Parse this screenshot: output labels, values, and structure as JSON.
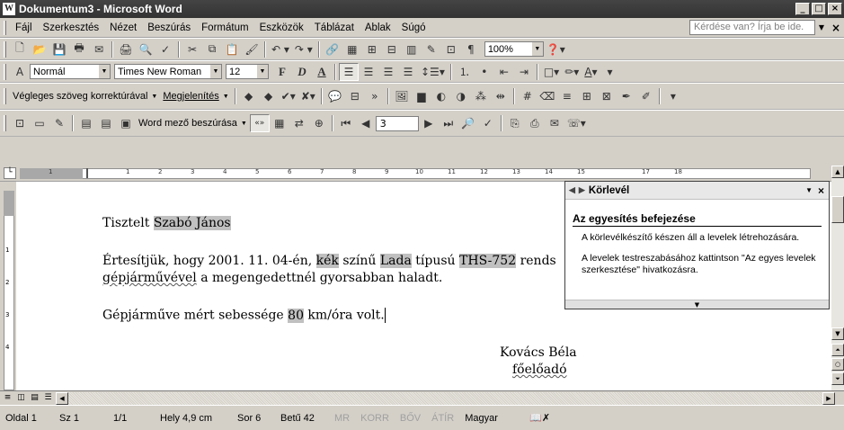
{
  "window": {
    "title": "Dokumentum3 - Microsoft Word",
    "minimize": "_",
    "maximize": "□",
    "close": "×"
  },
  "menu": {
    "items": [
      {
        "label": "Fájl"
      },
      {
        "label": "Szerkesztés"
      },
      {
        "label": "Nézet"
      },
      {
        "label": "Beszúrás"
      },
      {
        "label": "Formátum"
      },
      {
        "label": "Eszközök"
      },
      {
        "label": "Táblázat"
      },
      {
        "label": "Ablak"
      },
      {
        "label": "Súgó"
      }
    ],
    "help_placeholder": "Kérdése van? Írja be ide.",
    "close": "×"
  },
  "standard_toolbar": {
    "zoom": "100%"
  },
  "formatting_toolbar": {
    "style": "Normál",
    "font": "Times New Roman",
    "size": "12",
    "bold": "F",
    "italic": "D",
    "underline": "A"
  },
  "reviewing_toolbar": {
    "view": "Végleges szöveg korrektúrával",
    "show": "Megjelenítés"
  },
  "mailmerge_toolbar": {
    "insert_field": "Word mező beszúrása",
    "abc_label": "«»",
    "record": "3"
  },
  "document": {
    "line1_prefix": "Tisztelt ",
    "line1_field": "Szabó János",
    "line2_a": "Értesítjük, hogy 2001. 11. 04-én, ",
    "line2_color": "kék",
    "line2_b": " színű ",
    "line2_brand": "Lada",
    "line2_c": " típusú ",
    "line2_plate": "THS-752",
    "line2_d": " rends",
    "line3_word": "gépjárművével",
    "line3_rest": " a megengedettnél gyorsabban haladt.",
    "line4_a": "Gépjárműve mért sebessége ",
    "line4_speed": "80",
    "line4_b": " km/óra volt.",
    "sig_name": "Kovács Béla",
    "sig_title": "főelőadó"
  },
  "taskpane": {
    "title": "Körlevél",
    "section": "Az egyesítés befejezése",
    "p1": "A körlevélkészítő készen áll a levelek létrehozására.",
    "p2": "A levelek testreszabásához kattintson \"Az egyes levelek szerkesztése\" hivatkozásra."
  },
  "statusbar": {
    "page": "Oldal 1",
    "section": "Sz 1",
    "pages": "1/1",
    "position": "Hely 4,9 cm",
    "line": "Sor 6",
    "column": "Betű 42",
    "rec": "MR",
    "trk": "KORR",
    "ext": "BŐV",
    "ovr": "ÁTÍR",
    "language": "Magyar"
  }
}
